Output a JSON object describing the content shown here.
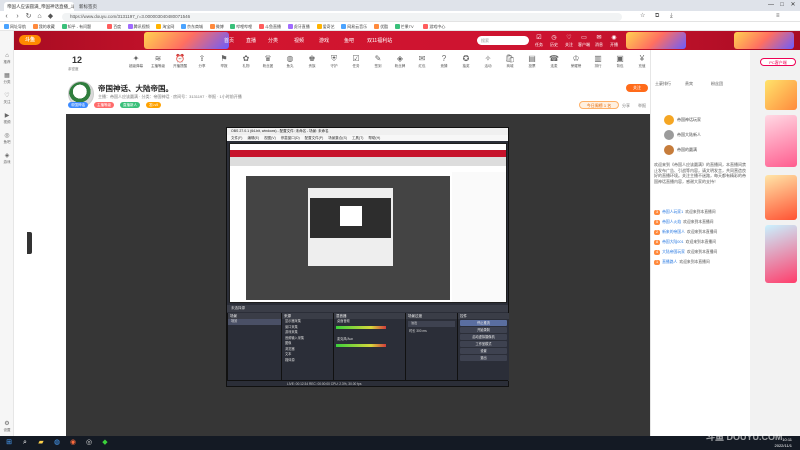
{
  "browser": {
    "tabs": [
      {
        "label": "帝国人应该圆满_帝国神话直播_斗鱼",
        "active": true
      },
      {
        "label": "新标签页",
        "active": false
      }
    ],
    "url": "https://www.douyu.com/3131197_r=3.000003040480071546",
    "window_controls": [
      "—",
      "□",
      "✕"
    ],
    "bookmarks": [
      "网址导航",
      "我的收藏",
      "知乎 - 有问题",
      "百度",
      "腾讯视频",
      "淘宝网",
      "京东商城",
      "微博",
      "哔哩哔哩",
      "斗鱼直播",
      "虎牙直播",
      "爱奇艺",
      "网易云音乐",
      "优酷",
      "芒果TV",
      "游戏中心"
    ]
  },
  "site_header": {
    "logo": "斗鱼",
    "nav": [
      "首页",
      "直播",
      "分类",
      "视频",
      "游戏",
      "鱼吧",
      "双11福利站"
    ],
    "search_placeholder": "搜索",
    "icons": [
      "任务",
      "历史",
      "关注",
      "客户端",
      "消息",
      "开播"
    ]
  },
  "left_rail": [
    {
      "icon": "home-icon",
      "label": "推荐"
    },
    {
      "icon": "grid-icon",
      "label": "分类"
    },
    {
      "icon": "follow-icon",
      "label": "关注"
    },
    {
      "icon": "video-icon",
      "label": "视频"
    },
    {
      "icon": "fish-icon",
      "label": "鱼吧"
    },
    {
      "icon": "game-icon",
      "label": "游戏"
    },
    {
      "icon": "settings-icon",
      "label": "设置"
    }
  ],
  "icon_bar": {
    "count": "12",
    "count_label": "亲密度",
    "items": [
      "超级弹幕",
      "主播等级",
      "开播提醒",
      "分享",
      "举报",
      "礼物",
      "粉丝团",
      "鱼丸",
      "贵族",
      "守护",
      "任务",
      "签到",
      "粉丝牌",
      "红包",
      "竞猜",
      "抽奖",
      "活动",
      "商城",
      "投票",
      "连麦",
      "荣耀榜",
      "排行",
      "背包",
      "充值"
    ]
  },
  "room": {
    "title": "帝国神话、大陆帝国。",
    "meta": "主播：帝国人应该圆满 · 分类：帝国神话 · 房间号：3131197 · 举报 · 1小时前开播",
    "tags": [
      {
        "text": "帝国神话",
        "color": "#3d8bff"
      },
      {
        "text": "主播等级",
        "color": "#ff6b6b"
      },
      {
        "text": "直播新人",
        "color": "#3ac07a"
      },
      {
        "text": "发Lv5",
        "color": "#ffa200"
      }
    ],
    "rank": "今日周榜 1 名",
    "share": "分享",
    "report": "举报",
    "follow": "关注"
  },
  "obs": {
    "title": "OBS 27.0.1 (64-bit, windows) - 配置文件: 未命名 - 场景: 未命名",
    "menu": [
      "文件(F)",
      "编辑(E)",
      "视图(V)",
      "停靠窗口(D)",
      "配置文件(P)",
      "场景集合(S)",
      "工具(T)",
      "帮助(H)"
    ],
    "control_bar": "未选择源",
    "docks": {
      "scenes": {
        "title": "场景",
        "items": [
          "场景"
        ]
      },
      "sources": {
        "title": "来源",
        "items": [
          "显示器采集",
          "窗口采集",
          "游戏采集",
          "音频输入采集",
          "图像",
          "浏览器",
          "文本",
          "媒体源"
        ]
      },
      "mixer": {
        "title": "混音器",
        "items": [
          "桌面音频",
          "麦克风/Aux"
        ]
      },
      "transitions": {
        "title": "场景过渡",
        "items": [
          "淡出",
          "时长 300 ms"
        ]
      },
      "controls": {
        "title": "控件",
        "items": [
          "停止推流",
          "开始录制",
          "启动虚拟摄像机",
          "工作室模式",
          "设置",
          "退出"
        ]
      }
    },
    "status": "LIVE: 00:12:34   REC: 00:00:00   CPU: 2.3%, 30.00 fps"
  },
  "right_panel": {
    "top_button": "PC客户端",
    "tabs": [
      "土豪排行",
      "贵宾",
      "粉丝团"
    ],
    "ranks": [
      {
        "name": "帝国神话玩家",
        "color": "#f5a623"
      },
      {
        "name": "帝国大陆新人",
        "color": "#9b9b9b"
      },
      {
        "name": "帝国的圆满",
        "color": "#c67c3b"
      }
    ],
    "notice": "欢迎来到《帝国人应该圆满》的直播间，本直播间禁止发布广告、引战等内容，请文明发言，共同营造良好的直播环境。关注主播不迷路，每天都有精彩的帝国神话直播内容，感谢大家的支持！",
    "chat": [
      {
        "level": "3",
        "name": "帝国人玩家1",
        "text": "欢迎来到本直播间"
      },
      {
        "level": "5",
        "name": "帝国人火焰",
        "text": "欢迎来到本直播间"
      },
      {
        "level": "2",
        "name": "新来的帝国人",
        "text": "欢迎来到本直播间"
      },
      {
        "level": "8",
        "name": "帝国大陆001",
        "text": "欢迎来到本直播间"
      },
      {
        "level": "4",
        "name": "大陆帝国玩家",
        "text": "欢迎来到本直播间"
      },
      {
        "level": "1",
        "name": "直播路人",
        "text": "欢迎来到本直播间"
      }
    ]
  },
  "taskbar": {
    "time": "10:11",
    "date": "2022/11/1"
  },
  "watermark": "斗鱼 DOUYU.COM"
}
